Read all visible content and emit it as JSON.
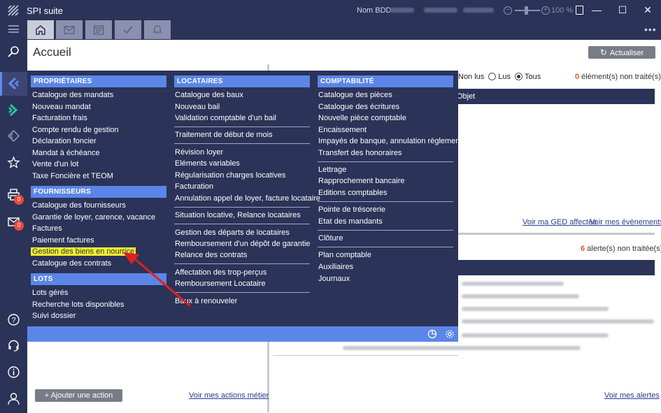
{
  "window": {
    "title": "SPI suite",
    "bdd_label": "Nom BDD",
    "zoom": "100 %"
  },
  "topnav": {
    "tabs": [
      "home-icon",
      "mail-icon",
      "calendar-icon",
      "check-icon",
      "bell-icon"
    ]
  },
  "sidebar": {
    "badges": {
      "print": "0",
      "mail": "0"
    }
  },
  "page": {
    "title": "Accueil",
    "refresh_label": "Actualiser",
    "add_action_label": "+ Ajouter une action métier",
    "see_actions_label": "Voir mes actions métier"
  },
  "right_pane": {
    "filter_non_lus": "Non lus",
    "filter_lus": "Lus",
    "filter_tous": "Tous",
    "selected_filter": "Tous",
    "untreated_count": "0",
    "untreated_label": " élément(s) non traité(s)",
    "column_objet": "Objet",
    "link_ged": "Voir ma GED affectée",
    "link_events": "Voir mes évènements",
    "alert_count": "6",
    "alert_label": " alerte(s) non traitée(s)",
    "link_alerts": "Voir mes alertes"
  },
  "menu": {
    "proprietaires": {
      "header": "PROPRIÉTAIRES",
      "items": [
        "Catalogue des mandats",
        "Nouveau mandat",
        "Facturation frais",
        "Compte rendu de gestion",
        "Déclaration foncier",
        "Mandat à échéance",
        "Vente d'un lot",
        "Taxe Foncière et TEOM"
      ]
    },
    "fournisseurs": {
      "header": "FOURNISSEURS",
      "items": [
        "Catalogue des fournisseurs",
        "Garantie de loyer, carence, vacance",
        "Factures",
        "Paiement factures",
        "Gestion des biens en nourrice",
        "Catalogue des contrats"
      ]
    },
    "lots": {
      "header": "LOTS",
      "items": [
        "Lots gérés",
        "Recherche lots disponibles",
        "Suivi dossier"
      ]
    },
    "locataires": {
      "header": "LOCATAIRES",
      "items": [
        "Catalogue des baux",
        "Nouveau bail",
        "Validation comptable d'un bail",
        "Traitement de début de mois",
        "Révision loyer",
        "Eléments variables",
        "Régularisation charges locatives",
        "Facturation",
        "Annulation appel de loyer, facture locataire",
        "Situation locative, Relance locataires",
        "Gestion des départs de locataires",
        "Remboursement d'un dépôt de garantie",
        "Relance des contrats",
        "Affectation des trop-perçus",
        "Remboursement Locataire",
        "Baux à renouveler"
      ]
    },
    "comptabilite": {
      "header": "COMPTABILITÉ",
      "items": [
        "Catalogue des pièces",
        "Catalogue des écritures",
        "Nouvelle pièce comptable",
        "Encaissement",
        "Impayés de banque, annulation règlement",
        "Transfert des honoraires",
        "Lettrage",
        "Rapprochement bancaire",
        "Editions comptables",
        "Pointe de trésorerie",
        "Etat des mandants",
        "Clôture",
        "Plan comptable",
        "Auxiliaires",
        "Journaux"
      ]
    }
  },
  "colors": {
    "navy": "#2b3358",
    "accent_blue": "#5b86e8",
    "highlight": "#f4ef2a",
    "arrow": "#e02020",
    "count_orange": "#e0581a"
  }
}
